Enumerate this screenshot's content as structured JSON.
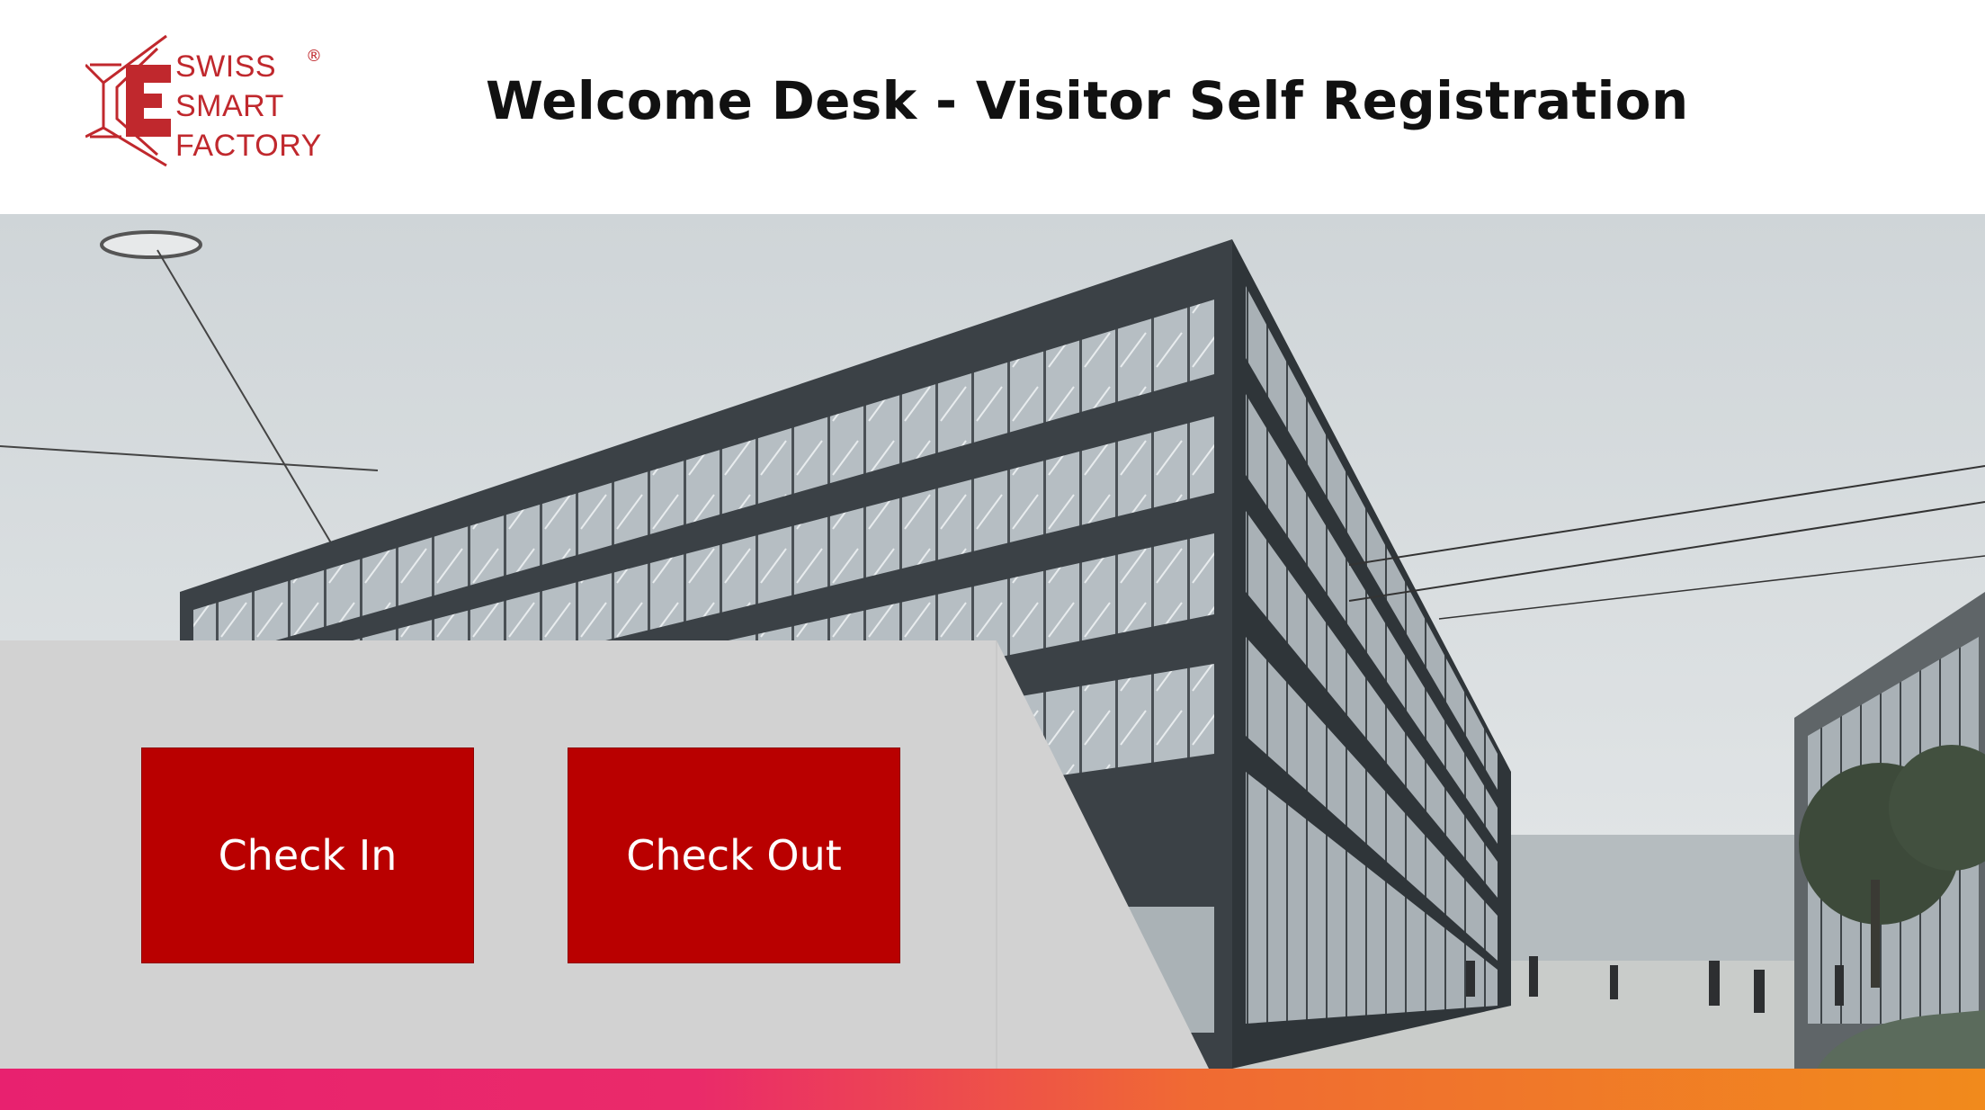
{
  "brand": {
    "line1": "SWISS",
    "line2": "SMART",
    "line3": "FACTORY",
    "registered": "®",
    "color": "#c0282d"
  },
  "header": {
    "title": "Welcome Desk - Visitor Self Registration"
  },
  "actions": {
    "check_in_label": "Check In",
    "check_out_label": "Check Out",
    "button_color": "#b90000"
  },
  "hero": {
    "image_subject": "modern glass office building"
  }
}
